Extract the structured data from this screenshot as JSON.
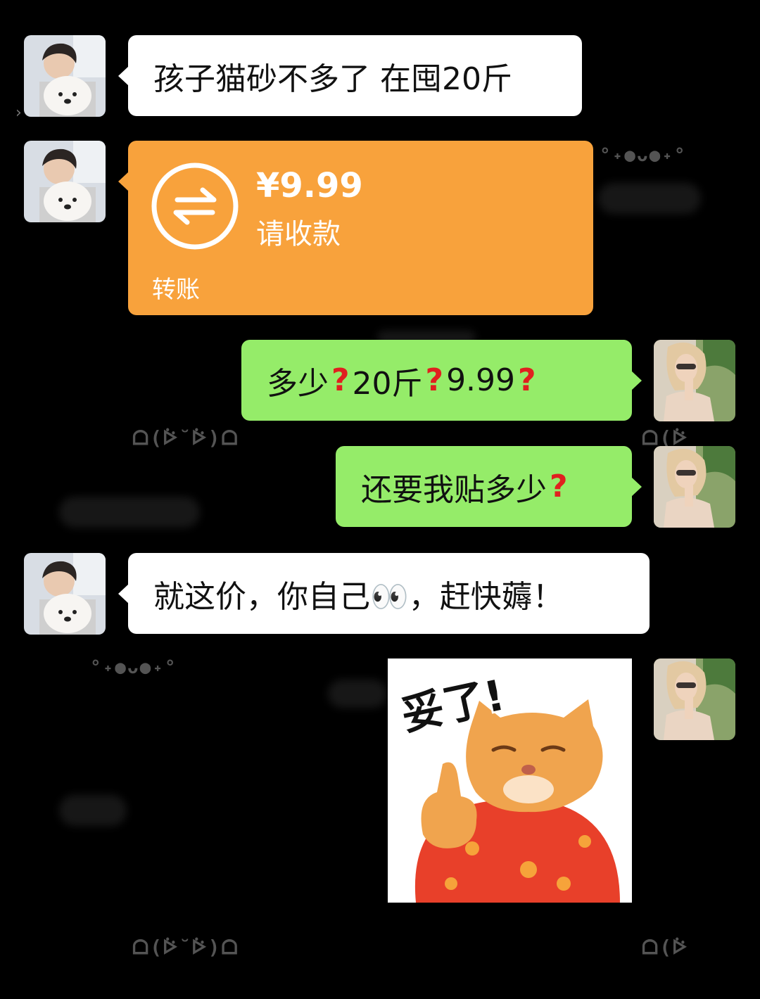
{
  "messages": {
    "m1": "孩子猫砂不多了 在囤20斤",
    "m3_a": "多少",
    "m3_b": "20斤",
    "m3_c": "9.99",
    "m3_q": "?",
    "m4": "还要我贴多少",
    "m5": "就这价，你自己👀，赶快薅！"
  },
  "transfer": {
    "amount": "¥9.99",
    "status": "请收款",
    "label": "转账"
  },
  "sticker": {
    "caption": "妥了!"
  },
  "decorations": {
    "face_a": "ᗝ(ᐖ˘ᐖ)ᗝ",
    "face_b": "ᗝ(ᐖ˘ᐖ)ᗝ",
    "face_c": "ᗝ(ᐖ",
    "face_d": "ᗝ(ᐖ",
    "dots": "°˖●ᴗ●˖°"
  },
  "colors": {
    "incoming_bubble": "#ffffff",
    "outgoing_bubble": "#95ec69",
    "transfer_card": "#f8a23c",
    "question_mark": "#e0201f",
    "background": "#000000"
  },
  "icons": {
    "transfer": "swap-arrows-icon",
    "sent_avatar": "avatar-woman",
    "received_avatar": "avatar-man-with-dog"
  }
}
